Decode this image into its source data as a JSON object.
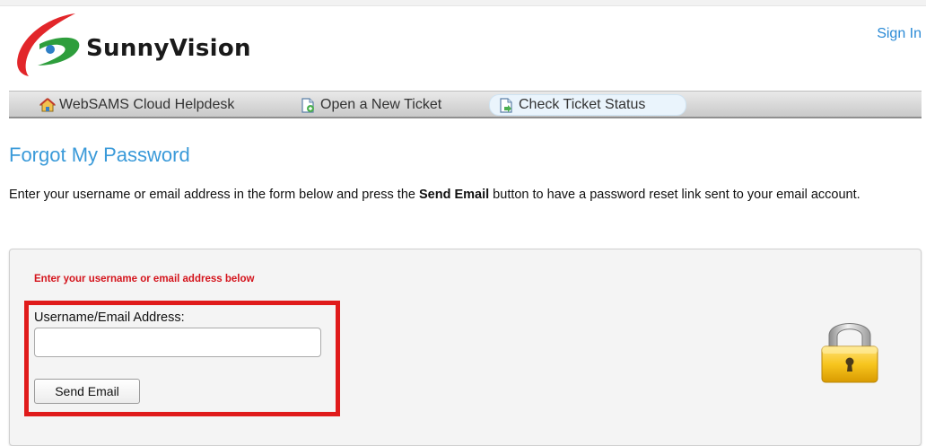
{
  "brand": {
    "name": "SunnyVision",
    "logo_icon": "sunnyvision-swoosh-logo",
    "colors": {
      "red": "#e2262a",
      "green": "#2e9e3c",
      "blue": "#2e7fc5"
    }
  },
  "header": {
    "sign_in_label": "Sign In"
  },
  "nav": {
    "items": [
      {
        "label": "WebSAMS Cloud Helpdesk",
        "icon": "home-icon"
      },
      {
        "label": "Open a New Ticket",
        "icon": "new-ticket-icon"
      },
      {
        "label": "Check Ticket Status",
        "icon": "ticket-status-icon",
        "active": true
      }
    ]
  },
  "page": {
    "title": "Forgot My Password",
    "intro_before": "Enter your username or email address in the form below and press the ",
    "intro_bold": "Send Email",
    "intro_after": " button to have a password reset link sent to your email account."
  },
  "form": {
    "message": "Enter your username or email address below",
    "field_label": "Username/Email Address:",
    "field_value": "",
    "submit_label": "Send Email",
    "lock_icon": "padlock-icon"
  },
  "colors": {
    "title_blue": "#3a9ad9",
    "message_red": "#d4141c",
    "highlight_red": "#e01b1b",
    "link_blue": "#2a8ad6"
  }
}
